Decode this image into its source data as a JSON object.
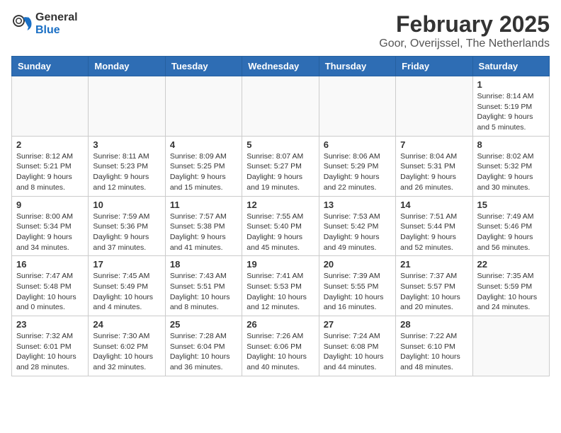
{
  "logo": {
    "text_general": "General",
    "text_blue": "Blue"
  },
  "title": "February 2025",
  "subtitle": "Goor, Overijssel, The Netherlands",
  "weekdays": [
    "Sunday",
    "Monday",
    "Tuesday",
    "Wednesday",
    "Thursday",
    "Friday",
    "Saturday"
  ],
  "weeks": [
    [
      {
        "day": "",
        "info": ""
      },
      {
        "day": "",
        "info": ""
      },
      {
        "day": "",
        "info": ""
      },
      {
        "day": "",
        "info": ""
      },
      {
        "day": "",
        "info": ""
      },
      {
        "day": "",
        "info": ""
      },
      {
        "day": "1",
        "info": "Sunrise: 8:14 AM\nSunset: 5:19 PM\nDaylight: 9 hours and 5 minutes."
      }
    ],
    [
      {
        "day": "2",
        "info": "Sunrise: 8:12 AM\nSunset: 5:21 PM\nDaylight: 9 hours and 8 minutes."
      },
      {
        "day": "3",
        "info": "Sunrise: 8:11 AM\nSunset: 5:23 PM\nDaylight: 9 hours and 12 minutes."
      },
      {
        "day": "4",
        "info": "Sunrise: 8:09 AM\nSunset: 5:25 PM\nDaylight: 9 hours and 15 minutes."
      },
      {
        "day": "5",
        "info": "Sunrise: 8:07 AM\nSunset: 5:27 PM\nDaylight: 9 hours and 19 minutes."
      },
      {
        "day": "6",
        "info": "Sunrise: 8:06 AM\nSunset: 5:29 PM\nDaylight: 9 hours and 22 minutes."
      },
      {
        "day": "7",
        "info": "Sunrise: 8:04 AM\nSunset: 5:31 PM\nDaylight: 9 hours and 26 minutes."
      },
      {
        "day": "8",
        "info": "Sunrise: 8:02 AM\nSunset: 5:32 PM\nDaylight: 9 hours and 30 minutes."
      }
    ],
    [
      {
        "day": "9",
        "info": "Sunrise: 8:00 AM\nSunset: 5:34 PM\nDaylight: 9 hours and 34 minutes."
      },
      {
        "day": "10",
        "info": "Sunrise: 7:59 AM\nSunset: 5:36 PM\nDaylight: 9 hours and 37 minutes."
      },
      {
        "day": "11",
        "info": "Sunrise: 7:57 AM\nSunset: 5:38 PM\nDaylight: 9 hours and 41 minutes."
      },
      {
        "day": "12",
        "info": "Sunrise: 7:55 AM\nSunset: 5:40 PM\nDaylight: 9 hours and 45 minutes."
      },
      {
        "day": "13",
        "info": "Sunrise: 7:53 AM\nSunset: 5:42 PM\nDaylight: 9 hours and 49 minutes."
      },
      {
        "day": "14",
        "info": "Sunrise: 7:51 AM\nSunset: 5:44 PM\nDaylight: 9 hours and 52 minutes."
      },
      {
        "day": "15",
        "info": "Sunrise: 7:49 AM\nSunset: 5:46 PM\nDaylight: 9 hours and 56 minutes."
      }
    ],
    [
      {
        "day": "16",
        "info": "Sunrise: 7:47 AM\nSunset: 5:48 PM\nDaylight: 10 hours and 0 minutes."
      },
      {
        "day": "17",
        "info": "Sunrise: 7:45 AM\nSunset: 5:49 PM\nDaylight: 10 hours and 4 minutes."
      },
      {
        "day": "18",
        "info": "Sunrise: 7:43 AM\nSunset: 5:51 PM\nDaylight: 10 hours and 8 minutes."
      },
      {
        "day": "19",
        "info": "Sunrise: 7:41 AM\nSunset: 5:53 PM\nDaylight: 10 hours and 12 minutes."
      },
      {
        "day": "20",
        "info": "Sunrise: 7:39 AM\nSunset: 5:55 PM\nDaylight: 10 hours and 16 minutes."
      },
      {
        "day": "21",
        "info": "Sunrise: 7:37 AM\nSunset: 5:57 PM\nDaylight: 10 hours and 20 minutes."
      },
      {
        "day": "22",
        "info": "Sunrise: 7:35 AM\nSunset: 5:59 PM\nDaylight: 10 hours and 24 minutes."
      }
    ],
    [
      {
        "day": "23",
        "info": "Sunrise: 7:32 AM\nSunset: 6:01 PM\nDaylight: 10 hours and 28 minutes."
      },
      {
        "day": "24",
        "info": "Sunrise: 7:30 AM\nSunset: 6:02 PM\nDaylight: 10 hours and 32 minutes."
      },
      {
        "day": "25",
        "info": "Sunrise: 7:28 AM\nSunset: 6:04 PM\nDaylight: 10 hours and 36 minutes."
      },
      {
        "day": "26",
        "info": "Sunrise: 7:26 AM\nSunset: 6:06 PM\nDaylight: 10 hours and 40 minutes."
      },
      {
        "day": "27",
        "info": "Sunrise: 7:24 AM\nSunset: 6:08 PM\nDaylight: 10 hours and 44 minutes."
      },
      {
        "day": "28",
        "info": "Sunrise: 7:22 AM\nSunset: 6:10 PM\nDaylight: 10 hours and 48 minutes."
      },
      {
        "day": "",
        "info": ""
      }
    ]
  ]
}
